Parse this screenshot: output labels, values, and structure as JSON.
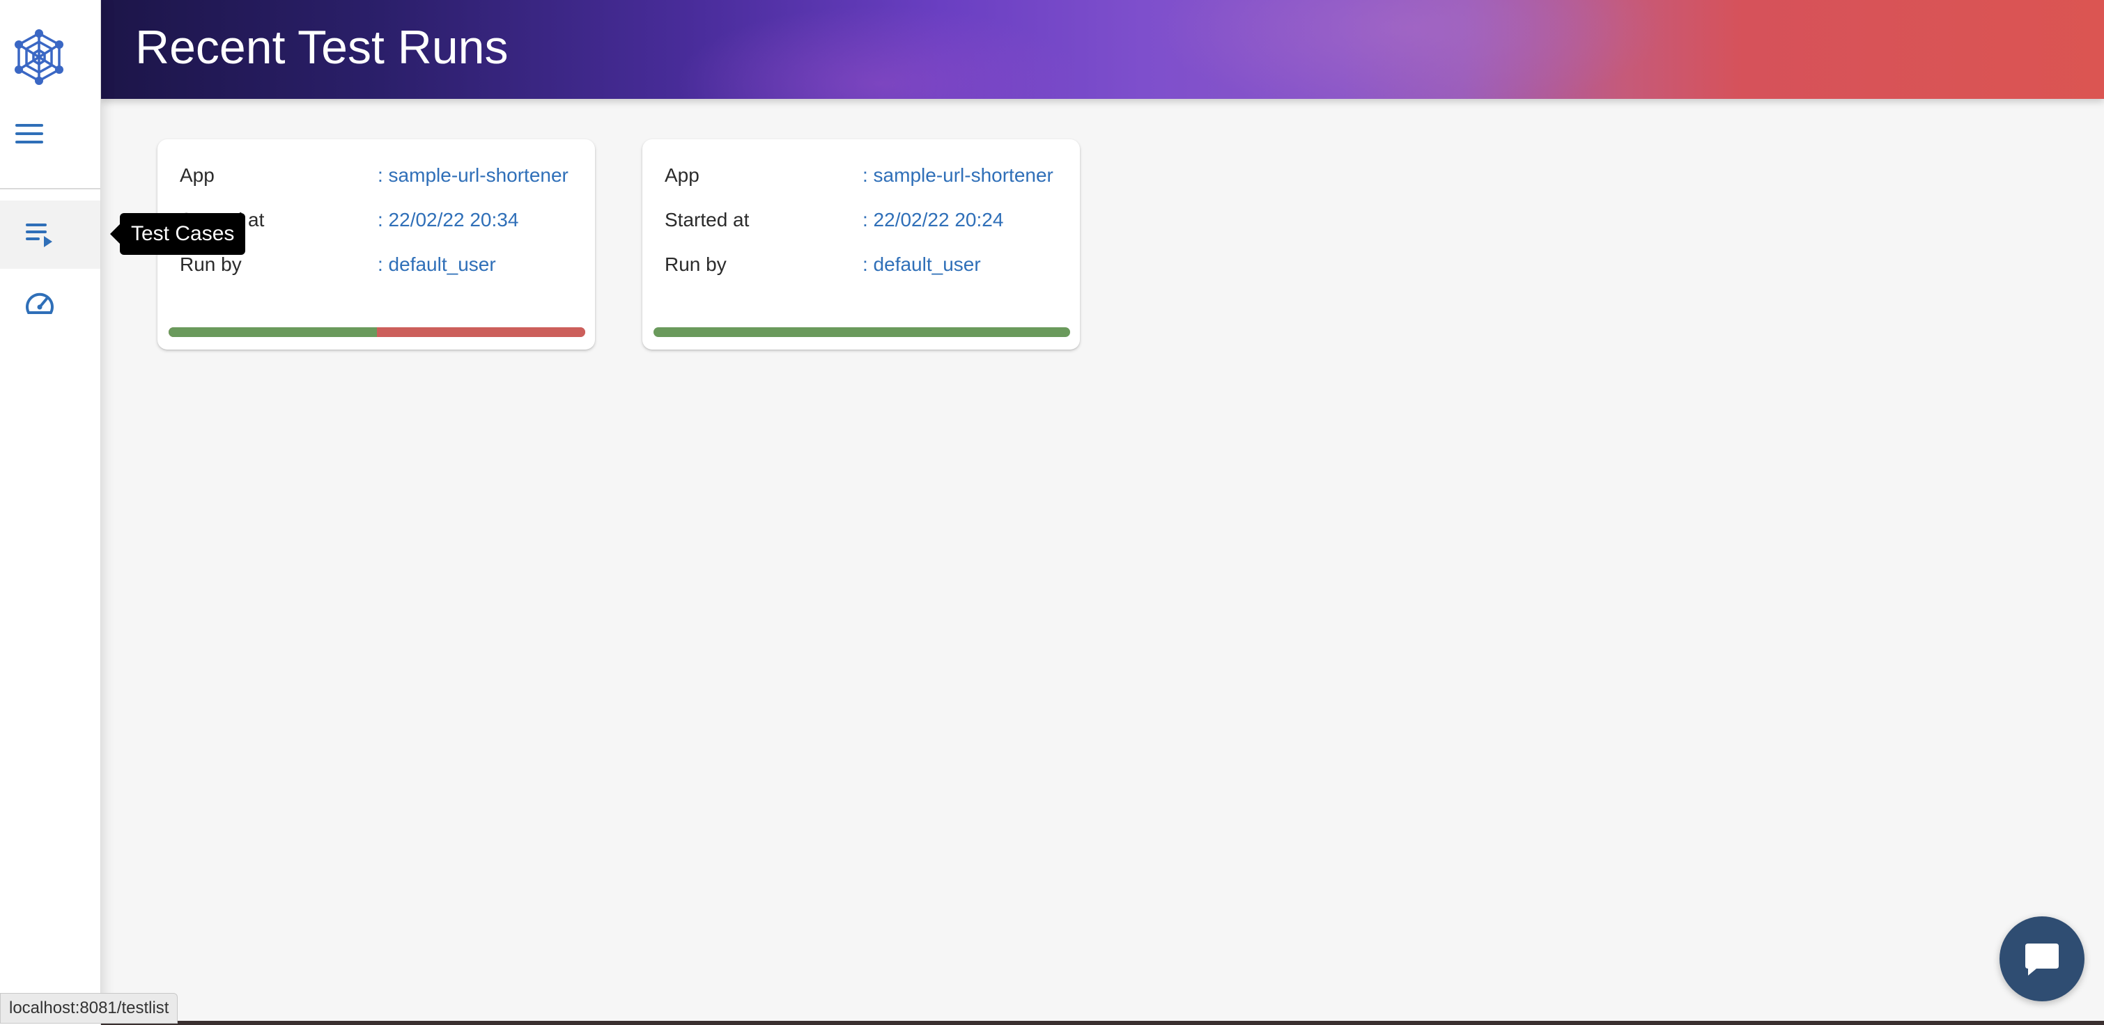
{
  "header": {
    "title": "Recent Test Runs"
  },
  "sidebar": {
    "logo_icon": "web-network-logo-icon",
    "menu_icon": "hamburger-menu-icon",
    "items": [
      {
        "id": "test-cases",
        "icon": "playlist-play-icon",
        "tooltip": "Test Cases",
        "active": true
      },
      {
        "id": "dashboard",
        "icon": "speedometer-icon",
        "active": false
      }
    ]
  },
  "tooltip": {
    "text": "Test Cases"
  },
  "runs": [
    {
      "app_label": "App",
      "app_value": ": sample-url-shortener",
      "started_label": "Started at",
      "started_value": ": 22/02/22 20:34",
      "runby_label": "Run by",
      "runby_value": ": default_user",
      "pass_fraction": 0.5
    },
    {
      "app_label": "App",
      "app_value": ": sample-url-shortener",
      "started_label": "Started at",
      "started_value": ": 22/02/22 20:24",
      "runby_label": "Run by",
      "runby_value": ": default_user",
      "pass_fraction": 1.0
    }
  ],
  "status_bar": {
    "url": "localhost:8081/testlist"
  },
  "chat": {
    "icon": "chat-bubble-icon"
  },
  "colors": {
    "accent": "#2f6fb8",
    "pass": "#6a9a5c",
    "fail": "#cc5f5b",
    "chat": "#2f4d72"
  }
}
